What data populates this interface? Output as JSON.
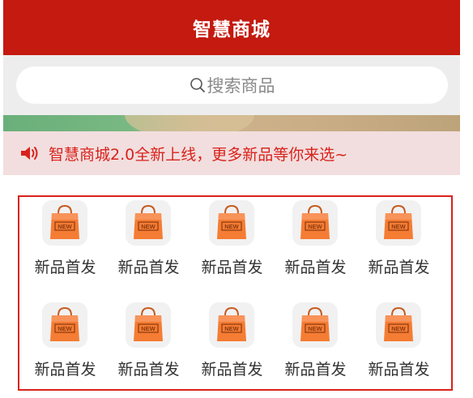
{
  "header": {
    "title": "智慧商城"
  },
  "search": {
    "placeholder": "搜索商品"
  },
  "notice": {
    "text": "智慧商城2.0全新上线，更多新品等你来选~"
  },
  "colors": {
    "brand_red": "#c41a0f",
    "notice_red": "#d9221c",
    "notice_bg": "#f2dede",
    "icon_orange": "#f57c33"
  },
  "grid": {
    "items": [
      {
        "label": "新品首发",
        "icon": "shopping-bag-new-icon",
        "badge": "NEW"
      },
      {
        "label": "新品首发",
        "icon": "shopping-bag-new-icon",
        "badge": "NEW"
      },
      {
        "label": "新品首发",
        "icon": "shopping-bag-new-icon",
        "badge": "NEW"
      },
      {
        "label": "新品首发",
        "icon": "shopping-bag-new-icon",
        "badge": "NEW"
      },
      {
        "label": "新品首发",
        "icon": "shopping-bag-new-icon",
        "badge": "NEW"
      },
      {
        "label": "新品首发",
        "icon": "shopping-bag-new-icon",
        "badge": "NEW"
      },
      {
        "label": "新品首发",
        "icon": "shopping-bag-new-icon",
        "badge": "NEW"
      },
      {
        "label": "新品首发",
        "icon": "shopping-bag-new-icon",
        "badge": "NEW"
      },
      {
        "label": "新品首发",
        "icon": "shopping-bag-new-icon",
        "badge": "NEW"
      },
      {
        "label": "新品首发",
        "icon": "shopping-bag-new-icon",
        "badge": "NEW"
      }
    ]
  }
}
